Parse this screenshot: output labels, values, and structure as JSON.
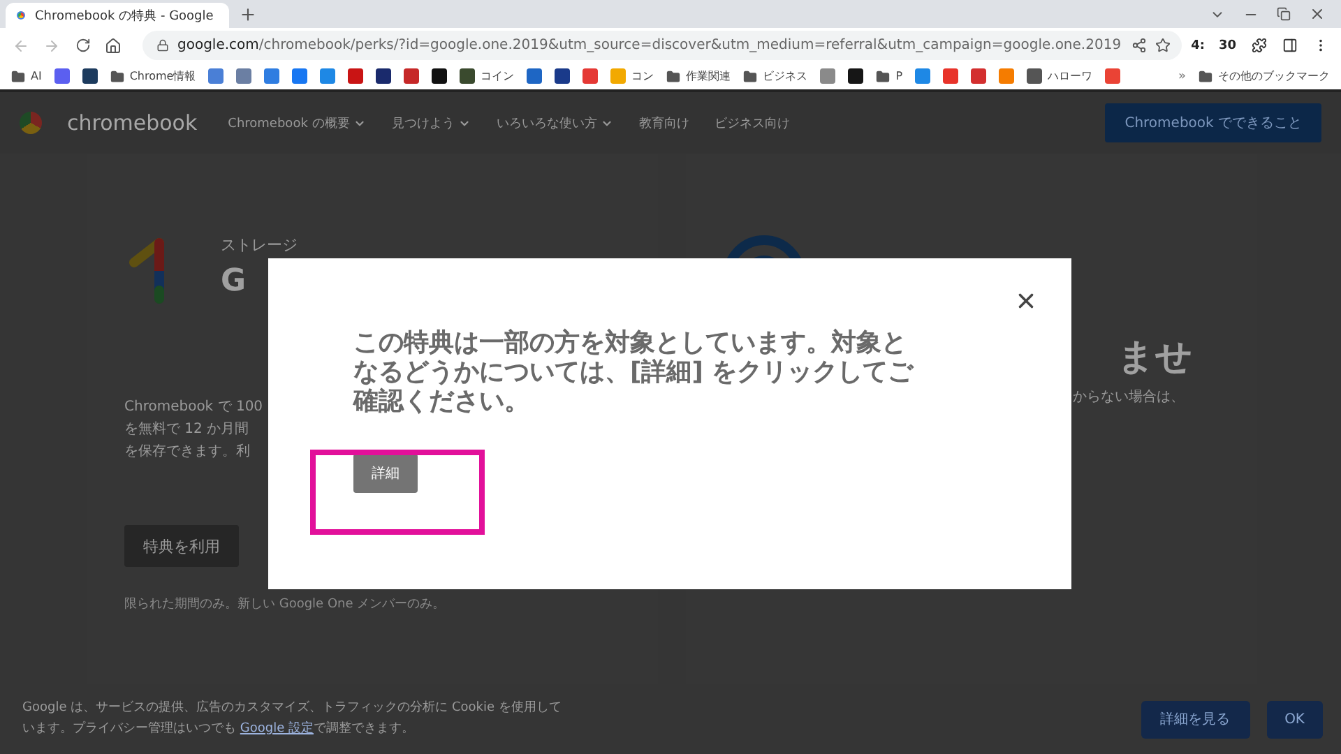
{
  "browser": {
    "tab": {
      "title": "Chromebook の特典 - Google",
      "selected": true
    },
    "url": {
      "domain": "google.com",
      "path": "/chromebook/perks/?id=google.one.2019&utm_source=discover&utm_medium=referral&utm_campaign=google.one.2019"
    },
    "extension_badge": [
      "4:",
      "30"
    ],
    "bookmarks": [
      {
        "kind": "folder",
        "label": "AI"
      },
      {
        "kind": "site",
        "color": "#5b5ff0"
      },
      {
        "kind": "site",
        "color": "#1d3b5e"
      },
      {
        "kind": "folder",
        "label": "Chrome情報"
      },
      {
        "kind": "site",
        "color": "#4a7fd6"
      },
      {
        "kind": "site",
        "color": "#6b7fa3"
      },
      {
        "kind": "site",
        "color": "#2f7de1"
      },
      {
        "kind": "site",
        "color": "#1877f2"
      },
      {
        "kind": "site",
        "color": "#1e88e5"
      },
      {
        "kind": "site",
        "color": "#c91414"
      },
      {
        "kind": "site",
        "color": "#1a2a6c"
      },
      {
        "kind": "site",
        "color": "#c62828"
      },
      {
        "kind": "site",
        "color": "#111111"
      },
      {
        "kind": "site",
        "color": "#3a4a2e",
        "label": "コイン"
      },
      {
        "kind": "site",
        "color": "#1e66c4"
      },
      {
        "kind": "site",
        "color": "#1a3a8a"
      },
      {
        "kind": "site",
        "color": "#e53935"
      },
      {
        "kind": "site",
        "color": "#f2a900",
        "label": "コン"
      },
      {
        "kind": "folder",
        "label": "作業関連"
      },
      {
        "kind": "folder",
        "label": "ビジネス"
      },
      {
        "kind": "site",
        "color": "#8a8a8a"
      },
      {
        "kind": "site",
        "color": "#161616"
      },
      {
        "kind": "folder",
        "label": "P"
      },
      {
        "kind": "site",
        "color": "#1e88e5"
      },
      {
        "kind": "site",
        "color": "#e8332a"
      },
      {
        "kind": "site",
        "color": "#d32f2f"
      },
      {
        "kind": "site",
        "color": "#f57c00"
      },
      {
        "kind": "site",
        "color": "#555555",
        "label": "ハローワ"
      },
      {
        "kind": "site",
        "color": "#ea4335"
      }
    ],
    "more_bookmarks": {
      "chevron": "»",
      "label": "その他のブックマーク"
    }
  },
  "site_nav": {
    "logo": "chromebook",
    "items": [
      {
        "label": "Chromebook の概要",
        "dropdown": true
      },
      {
        "label": "見つけよう",
        "dropdown": true
      },
      {
        "label": "いろいろな使い方",
        "dropdown": true
      },
      {
        "label": "教育向け",
        "dropdown": false
      },
      {
        "label": "ビジネス向け",
        "dropdown": false
      }
    ],
    "cta": "Chromebook でできること"
  },
  "cards": [
    {
      "eyebrow": "ストレージ",
      "title": "G",
      "body": [
        "Chromebook で 100",
        "を無料で 12 か月間",
        "を保存できます。利"
      ],
      "button": "特典を利用",
      "note": "限られた期間のみ。新しい Google One メンバーのみ。"
    },
    {
      "title": "ませ",
      "body": [
        "からない場合は、"
      ]
    }
  ],
  "cookie_banner": {
    "text_before": "Google は、サービスの提供、広告のカスタマイズ、トラフィックの分析に Cookie を使用しています。プライバシー管理はいつでも ",
    "link": "Google 設定",
    "text_after": "で調整できます。",
    "buttons": [
      "詳細を見る",
      "OK"
    ]
  },
  "modal": {
    "message": "この特典は一部の方を対象としています。対象となるどうかについては、[詳細] をクリックしてご確認ください。",
    "button": "詳細",
    "highlighted": true
  }
}
